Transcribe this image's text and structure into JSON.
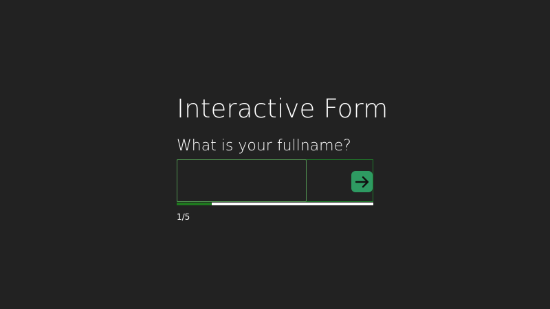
{
  "form": {
    "title": "Interactive Form",
    "question": "What is your fullname?",
    "answer_value": "",
    "answer_placeholder": "",
    "next_icon": "arrow-right-icon",
    "progress_fraction": 0.18,
    "step_counter": "1/5"
  },
  "colors": {
    "background": "#222222",
    "accent_green": "#2e9a62",
    "progress_fill": "#1e7a1e",
    "progress_track": "#ffffff",
    "text": "#ffffff"
  }
}
